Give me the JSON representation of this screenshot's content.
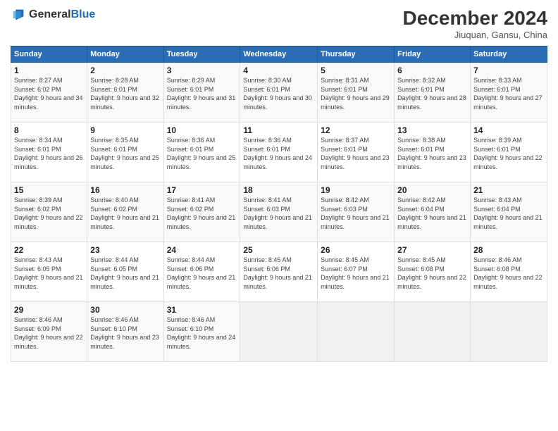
{
  "header": {
    "logo_general": "General",
    "logo_blue": "Blue",
    "month_title": "December 2024",
    "subtitle": "Jiuquan, Gansu, China"
  },
  "weekdays": [
    "Sunday",
    "Monday",
    "Tuesday",
    "Wednesday",
    "Thursday",
    "Friday",
    "Saturday"
  ],
  "weeks": [
    [
      {
        "day": "1",
        "sunrise": "8:27 AM",
        "sunset": "6:02 PM",
        "daylight": "9 hours and 34 minutes."
      },
      {
        "day": "2",
        "sunrise": "8:28 AM",
        "sunset": "6:01 PM",
        "daylight": "9 hours and 32 minutes."
      },
      {
        "day": "3",
        "sunrise": "8:29 AM",
        "sunset": "6:01 PM",
        "daylight": "9 hours and 31 minutes."
      },
      {
        "day": "4",
        "sunrise": "8:30 AM",
        "sunset": "6:01 PM",
        "daylight": "9 hours and 30 minutes."
      },
      {
        "day": "5",
        "sunrise": "8:31 AM",
        "sunset": "6:01 PM",
        "daylight": "9 hours and 29 minutes."
      },
      {
        "day": "6",
        "sunrise": "8:32 AM",
        "sunset": "6:01 PM",
        "daylight": "9 hours and 28 minutes."
      },
      {
        "day": "7",
        "sunrise": "8:33 AM",
        "sunset": "6:01 PM",
        "daylight": "9 hours and 27 minutes."
      }
    ],
    [
      {
        "day": "8",
        "sunrise": "8:34 AM",
        "sunset": "6:01 PM",
        "daylight": "9 hours and 26 minutes."
      },
      {
        "day": "9",
        "sunrise": "8:35 AM",
        "sunset": "6:01 PM",
        "daylight": "9 hours and 25 minutes."
      },
      {
        "day": "10",
        "sunrise": "8:36 AM",
        "sunset": "6:01 PM",
        "daylight": "9 hours and 25 minutes."
      },
      {
        "day": "11",
        "sunrise": "8:36 AM",
        "sunset": "6:01 PM",
        "daylight": "9 hours and 24 minutes."
      },
      {
        "day": "12",
        "sunrise": "8:37 AM",
        "sunset": "6:01 PM",
        "daylight": "9 hours and 23 minutes."
      },
      {
        "day": "13",
        "sunrise": "8:38 AM",
        "sunset": "6:01 PM",
        "daylight": "9 hours and 23 minutes."
      },
      {
        "day": "14",
        "sunrise": "8:39 AM",
        "sunset": "6:01 PM",
        "daylight": "9 hours and 22 minutes."
      }
    ],
    [
      {
        "day": "15",
        "sunrise": "8:39 AM",
        "sunset": "6:02 PM",
        "daylight": "9 hours and 22 minutes."
      },
      {
        "day": "16",
        "sunrise": "8:40 AM",
        "sunset": "6:02 PM",
        "daylight": "9 hours and 21 minutes."
      },
      {
        "day": "17",
        "sunrise": "8:41 AM",
        "sunset": "6:02 PM",
        "daylight": "9 hours and 21 minutes."
      },
      {
        "day": "18",
        "sunrise": "8:41 AM",
        "sunset": "6:03 PM",
        "daylight": "9 hours and 21 minutes."
      },
      {
        "day": "19",
        "sunrise": "8:42 AM",
        "sunset": "6:03 PM",
        "daylight": "9 hours and 21 minutes."
      },
      {
        "day": "20",
        "sunrise": "8:42 AM",
        "sunset": "6:04 PM",
        "daylight": "9 hours and 21 minutes."
      },
      {
        "day": "21",
        "sunrise": "8:43 AM",
        "sunset": "6:04 PM",
        "daylight": "9 hours and 21 minutes."
      }
    ],
    [
      {
        "day": "22",
        "sunrise": "8:43 AM",
        "sunset": "6:05 PM",
        "daylight": "9 hours and 21 minutes."
      },
      {
        "day": "23",
        "sunrise": "8:44 AM",
        "sunset": "6:05 PM",
        "daylight": "9 hours and 21 minutes."
      },
      {
        "day": "24",
        "sunrise": "8:44 AM",
        "sunset": "6:06 PM",
        "daylight": "9 hours and 21 minutes."
      },
      {
        "day": "25",
        "sunrise": "8:45 AM",
        "sunset": "6:06 PM",
        "daylight": "9 hours and 21 minutes."
      },
      {
        "day": "26",
        "sunrise": "8:45 AM",
        "sunset": "6:07 PM",
        "daylight": "9 hours and 21 minutes."
      },
      {
        "day": "27",
        "sunrise": "8:45 AM",
        "sunset": "6:08 PM",
        "daylight": "9 hours and 22 minutes."
      },
      {
        "day": "28",
        "sunrise": "8:46 AM",
        "sunset": "6:08 PM",
        "daylight": "9 hours and 22 minutes."
      }
    ],
    [
      {
        "day": "29",
        "sunrise": "8:46 AM",
        "sunset": "6:09 PM",
        "daylight": "9 hours and 22 minutes."
      },
      {
        "day": "30",
        "sunrise": "8:46 AM",
        "sunset": "6:10 PM",
        "daylight": "9 hours and 23 minutes."
      },
      {
        "day": "31",
        "sunrise": "8:46 AM",
        "sunset": "6:10 PM",
        "daylight": "9 hours and 24 minutes."
      },
      null,
      null,
      null,
      null
    ]
  ],
  "labels": {
    "sunrise": "Sunrise:",
    "sunset": "Sunset:",
    "daylight": "Daylight:"
  }
}
